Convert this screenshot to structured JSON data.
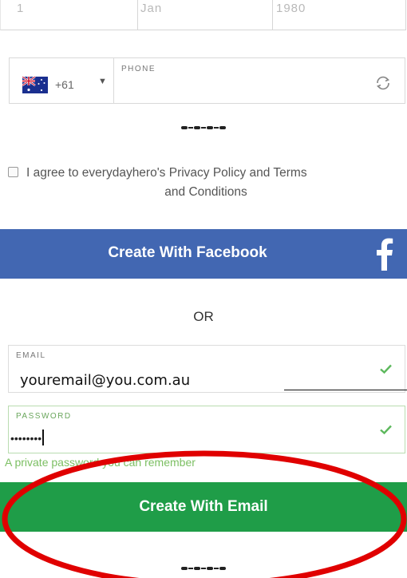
{
  "dob": {
    "day": "1",
    "month": "Jan",
    "year": "1980"
  },
  "phone": {
    "flag_icon": "australia-flag-icon",
    "country_code": "+61",
    "caret": "▼",
    "label": "PHONE",
    "refresh_icon": "refresh-icon"
  },
  "agree": {
    "line1": "I agree to everydayhero's Privacy Policy and Terms",
    "line2": "and Conditions",
    "checked": false
  },
  "facebook_button": {
    "label": "Create With Facebook",
    "icon": "facebook-f-icon",
    "color": "#4267b2"
  },
  "or_text": "OR",
  "email": {
    "label": "EMAIL",
    "value": "youremail@you.com.au",
    "valid_icon": "check-icon"
  },
  "password": {
    "label": "PASSWORD",
    "value": "••••••••",
    "valid_icon": "check-icon",
    "hint": "A private password you can remember"
  },
  "email_button": {
    "label": "Create With Email",
    "color": "#1f9d48"
  },
  "annotation": {
    "shape": "red-ellipse",
    "color": "#e00000"
  }
}
